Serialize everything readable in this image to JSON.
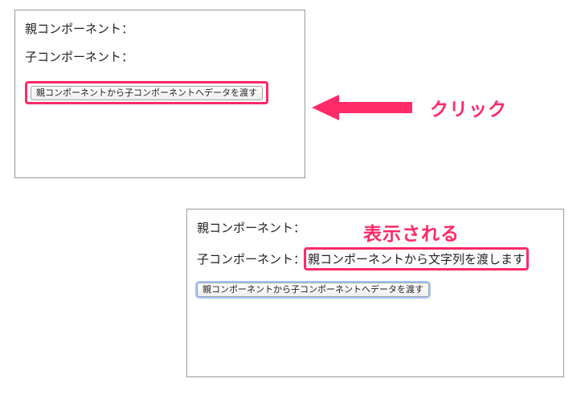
{
  "panel1": {
    "parent_label": "親コンポーネント：",
    "child_label": "子コンポーネント：",
    "child_value": "",
    "button_label": "親コンポーネントから子コンポーネントへデータを渡す"
  },
  "panel2": {
    "parent_label": "親コンポーネント：",
    "child_label": "子コンポーネント：",
    "child_value": "親コンポーネントから文字列を渡します",
    "button_label": "親コンポーネントから子コンポーネントへデータを渡す"
  },
  "annotations": {
    "click": "クリック",
    "shown": "表示される"
  },
  "colors": {
    "highlight": "#ff2a68",
    "panel_border": "#999999",
    "text": "#222222"
  }
}
